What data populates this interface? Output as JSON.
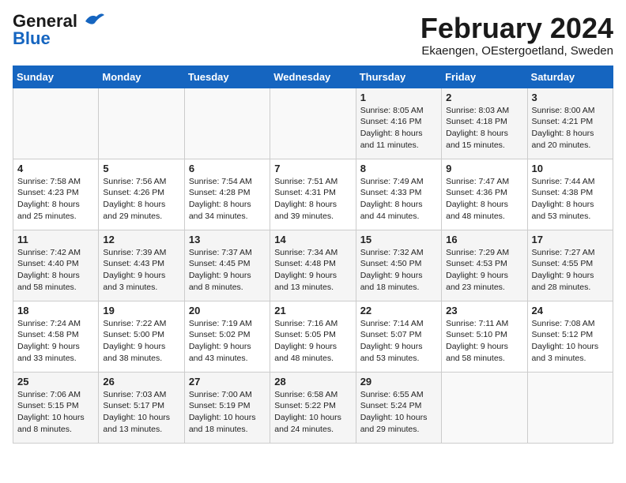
{
  "header": {
    "logo_general": "General",
    "logo_blue": "Blue",
    "month_title": "February 2024",
    "location": "Ekaengen, OEstergoetland, Sweden"
  },
  "days_of_week": [
    "Sunday",
    "Monday",
    "Tuesday",
    "Wednesday",
    "Thursday",
    "Friday",
    "Saturday"
  ],
  "weeks": [
    [
      {
        "day": "",
        "info": ""
      },
      {
        "day": "",
        "info": ""
      },
      {
        "day": "",
        "info": ""
      },
      {
        "day": "",
        "info": ""
      },
      {
        "day": "1",
        "info": "Sunrise: 8:05 AM\nSunset: 4:16 PM\nDaylight: 8 hours\nand 11 minutes."
      },
      {
        "day": "2",
        "info": "Sunrise: 8:03 AM\nSunset: 4:18 PM\nDaylight: 8 hours\nand 15 minutes."
      },
      {
        "day": "3",
        "info": "Sunrise: 8:00 AM\nSunset: 4:21 PM\nDaylight: 8 hours\nand 20 minutes."
      }
    ],
    [
      {
        "day": "4",
        "info": "Sunrise: 7:58 AM\nSunset: 4:23 PM\nDaylight: 8 hours\nand 25 minutes."
      },
      {
        "day": "5",
        "info": "Sunrise: 7:56 AM\nSunset: 4:26 PM\nDaylight: 8 hours\nand 29 minutes."
      },
      {
        "day": "6",
        "info": "Sunrise: 7:54 AM\nSunset: 4:28 PM\nDaylight: 8 hours\nand 34 minutes."
      },
      {
        "day": "7",
        "info": "Sunrise: 7:51 AM\nSunset: 4:31 PM\nDaylight: 8 hours\nand 39 minutes."
      },
      {
        "day": "8",
        "info": "Sunrise: 7:49 AM\nSunset: 4:33 PM\nDaylight: 8 hours\nand 44 minutes."
      },
      {
        "day": "9",
        "info": "Sunrise: 7:47 AM\nSunset: 4:36 PM\nDaylight: 8 hours\nand 48 minutes."
      },
      {
        "day": "10",
        "info": "Sunrise: 7:44 AM\nSunset: 4:38 PM\nDaylight: 8 hours\nand 53 minutes."
      }
    ],
    [
      {
        "day": "11",
        "info": "Sunrise: 7:42 AM\nSunset: 4:40 PM\nDaylight: 8 hours\nand 58 minutes."
      },
      {
        "day": "12",
        "info": "Sunrise: 7:39 AM\nSunset: 4:43 PM\nDaylight: 9 hours\nand 3 minutes."
      },
      {
        "day": "13",
        "info": "Sunrise: 7:37 AM\nSunset: 4:45 PM\nDaylight: 9 hours\nand 8 minutes."
      },
      {
        "day": "14",
        "info": "Sunrise: 7:34 AM\nSunset: 4:48 PM\nDaylight: 9 hours\nand 13 minutes."
      },
      {
        "day": "15",
        "info": "Sunrise: 7:32 AM\nSunset: 4:50 PM\nDaylight: 9 hours\nand 18 minutes."
      },
      {
        "day": "16",
        "info": "Sunrise: 7:29 AM\nSunset: 4:53 PM\nDaylight: 9 hours\nand 23 minutes."
      },
      {
        "day": "17",
        "info": "Sunrise: 7:27 AM\nSunset: 4:55 PM\nDaylight: 9 hours\nand 28 minutes."
      }
    ],
    [
      {
        "day": "18",
        "info": "Sunrise: 7:24 AM\nSunset: 4:58 PM\nDaylight: 9 hours\nand 33 minutes."
      },
      {
        "day": "19",
        "info": "Sunrise: 7:22 AM\nSunset: 5:00 PM\nDaylight: 9 hours\nand 38 minutes."
      },
      {
        "day": "20",
        "info": "Sunrise: 7:19 AM\nSunset: 5:02 PM\nDaylight: 9 hours\nand 43 minutes."
      },
      {
        "day": "21",
        "info": "Sunrise: 7:16 AM\nSunset: 5:05 PM\nDaylight: 9 hours\nand 48 minutes."
      },
      {
        "day": "22",
        "info": "Sunrise: 7:14 AM\nSunset: 5:07 PM\nDaylight: 9 hours\nand 53 minutes."
      },
      {
        "day": "23",
        "info": "Sunrise: 7:11 AM\nSunset: 5:10 PM\nDaylight: 9 hours\nand 58 minutes."
      },
      {
        "day": "24",
        "info": "Sunrise: 7:08 AM\nSunset: 5:12 PM\nDaylight: 10 hours\nand 3 minutes."
      }
    ],
    [
      {
        "day": "25",
        "info": "Sunrise: 7:06 AM\nSunset: 5:15 PM\nDaylight: 10 hours\nand 8 minutes."
      },
      {
        "day": "26",
        "info": "Sunrise: 7:03 AM\nSunset: 5:17 PM\nDaylight: 10 hours\nand 13 minutes."
      },
      {
        "day": "27",
        "info": "Sunrise: 7:00 AM\nSunset: 5:19 PM\nDaylight: 10 hours\nand 18 minutes."
      },
      {
        "day": "28",
        "info": "Sunrise: 6:58 AM\nSunset: 5:22 PM\nDaylight: 10 hours\nand 24 minutes."
      },
      {
        "day": "29",
        "info": "Sunrise: 6:55 AM\nSunset: 5:24 PM\nDaylight: 10 hours\nand 29 minutes."
      },
      {
        "day": "",
        "info": ""
      },
      {
        "day": "",
        "info": ""
      }
    ]
  ]
}
